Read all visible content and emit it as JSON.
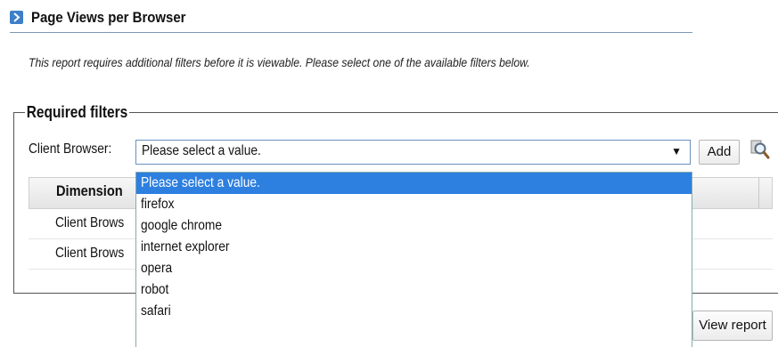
{
  "header": {
    "title": "Page Views per Browser",
    "icon": "arrow-right-icon"
  },
  "notice": "This report requires additional filters before it is viewable. Please select one of the available filters below.",
  "filters": {
    "legend": "Required filters",
    "label": "Client Browser:",
    "select_value": "Please select a value.",
    "add_label": "Add",
    "search_icon": "magnifier-icon",
    "options": [
      "Please select a value.",
      "firefox",
      "google chrome",
      "internet explorer",
      "opera",
      "robot",
      "safari"
    ]
  },
  "grid": {
    "columns": [
      "Dimension"
    ],
    "rows": [
      "Client Brows",
      "Client Brows"
    ]
  },
  "footer": {
    "view_report_label": "View report"
  },
  "colors": {
    "accent": "#2d7fe0",
    "header_rule": "#7a9ab8"
  }
}
